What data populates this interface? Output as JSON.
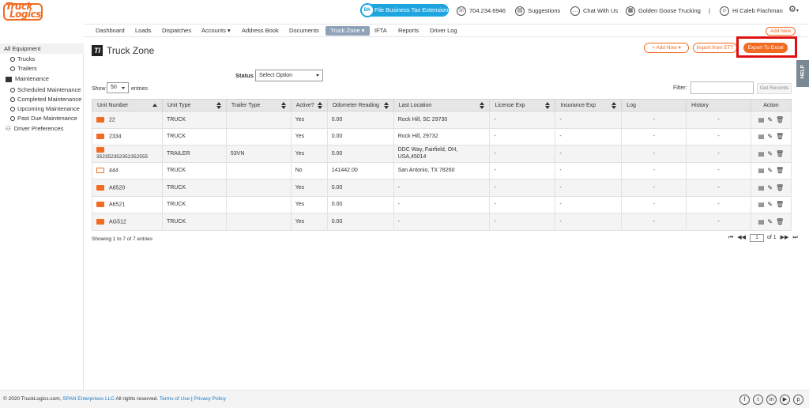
{
  "logo": {
    "line1": "Truck",
    "line2": "Logics"
  },
  "header": {
    "tax_button": "File Business Tax Extension",
    "tax_icon_text": "BK",
    "phone": "704.234.6946",
    "suggestions": "Suggestions",
    "chat": "Chat With Us",
    "company": "Golden Goose Trucking",
    "separator": "|",
    "greeting": "Hi Caleb Flachman"
  },
  "nav": {
    "items": [
      "Dashboard",
      "Loads",
      "Dispatches",
      "Accounts ▾",
      "Address Book",
      "Documents",
      "Truck Zone ▾",
      "IFTA",
      "Reports",
      "Driver Log"
    ],
    "add_new": "Add New"
  },
  "sidebar": {
    "all_equipment": "All Equipment",
    "trucks": "Trucks",
    "trailers": "Trailers",
    "maintenance": "Maintenance",
    "scheduled": "Scheduled Maintenance",
    "completed": "Completed Maintenance",
    "upcoming": "Upcoming Maintenance",
    "past_due": "Past Due Maintenance",
    "driver_prefs": "Driver Preferences"
  },
  "main": {
    "title_icon": "Tl",
    "title": "Truck Zone",
    "add_now": "+ Add Now ▾",
    "import": "Import from ETT",
    "export": "Export To Excel",
    "help": "HELP",
    "status_label": "Status",
    "status_value": "Select Option",
    "show_label": "Show",
    "show_value": "50",
    "entries_label": "entries",
    "filter_label": "Filter:",
    "get_records": "Get Records",
    "showing": "Showing 1 to 7 of 7 entries",
    "page_value": "1",
    "page_of": "of 1"
  },
  "table": {
    "headers": [
      "Unit Number",
      "Unit Type",
      "Trailer Type",
      "Active?",
      "Odometer Reading",
      "Last Location",
      "License Exp",
      "Insurance Exp",
      "Log",
      "History",
      "Action"
    ],
    "rows": [
      {
        "unit": "22",
        "type": "TRUCK",
        "trailer": "",
        "active": "Yes",
        "odo": "0.00",
        "loc": "Rock Hill, SC 29730",
        "lic": "-",
        "ins": "-",
        "log": "-",
        "hist": "-"
      },
      {
        "unit": "2334",
        "type": "TRUCK",
        "trailer": "",
        "active": "Yes",
        "odo": "0.00",
        "loc": "Rock Hill, 29732",
        "lic": "-",
        "ins": "-",
        "log": "-",
        "hist": "-"
      },
      {
        "unit": "352352352352352555",
        "type": "TRAILER",
        "trailer": "53VN",
        "active": "Yes",
        "odo": "0.00",
        "loc": "DDC Way, Fairfield, OH, USA,45014",
        "lic": "-",
        "ins": "-",
        "log": "-",
        "hist": "-"
      },
      {
        "unit": "444",
        "type": "TRUCK",
        "trailer": "",
        "active": "No",
        "odo": "141442.00",
        "loc": "San Antonio, TX 78260",
        "lic": "-",
        "ins": "-",
        "log": "-",
        "hist": "-"
      },
      {
        "unit": "A6520",
        "type": "TRUCK",
        "trailer": "",
        "active": "Yes",
        "odo": "0.00",
        "loc": "-",
        "lic": "-",
        "ins": "-",
        "log": "-",
        "hist": "-"
      },
      {
        "unit": "A6521",
        "type": "TRUCK",
        "trailer": "",
        "active": "Yes",
        "odo": "0.00",
        "loc": "-",
        "lic": "-",
        "ins": "-",
        "log": "-",
        "hist": "-"
      },
      {
        "unit": "AG512",
        "type": "TRUCK",
        "trailer": "",
        "active": "Yes",
        "odo": "0.00",
        "loc": "-",
        "lic": "-",
        "ins": "-",
        "log": "-",
        "hist": "-"
      }
    ]
  },
  "footer": {
    "copyright": "© 2020 TruckLogics.com,",
    "span": "SPAN Enterprises LLC",
    "rights": "All rights reserved.",
    "terms": "Terms of Use",
    "sep": "|",
    "privacy": "Privacy Policy"
  },
  "colors": {
    "accent": "#f26b22",
    "tax_blue": "#1ea5e0",
    "highlight_red": "#e01010",
    "nav_active": "#8fa3b8"
  },
  "icons": [
    "phone-icon",
    "suggestions-icon",
    "chat-icon",
    "company-icon",
    "user-icon",
    "gear-icon",
    "truck-icon",
    "trailer-icon",
    "document-icon",
    "edit-icon",
    "trash-icon",
    "facebook-icon",
    "twitter-icon",
    "linkedin-icon",
    "youtube-icon",
    "pinterest-icon"
  ]
}
